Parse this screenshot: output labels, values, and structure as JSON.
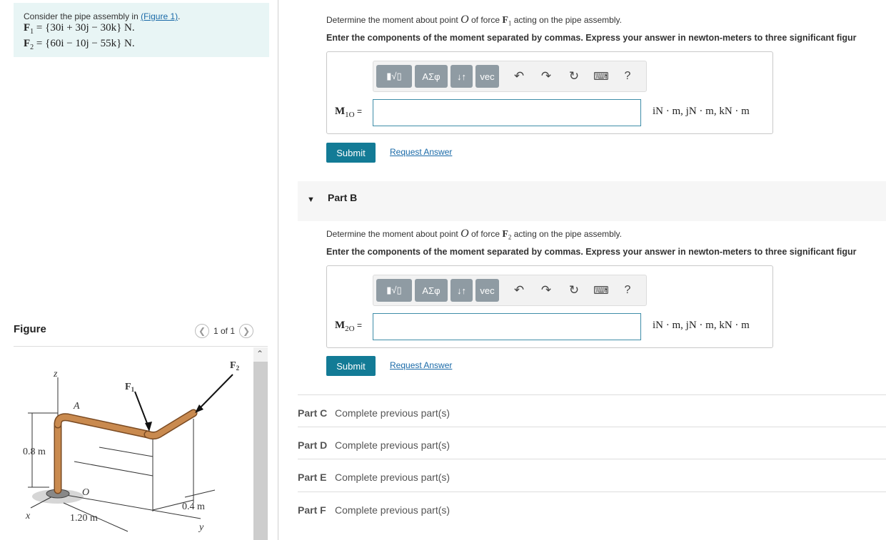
{
  "problem": {
    "intro": "Consider the pipe assembly in",
    "figure_link": "(Figure 1)",
    "period": ".",
    "f1_label": "F",
    "f1_sub": "1",
    "f1_eq": " = {30i + 30j − 30k} N.",
    "f2_label": "F",
    "f2_sub": "2",
    "f2_eq": " = {60i − 10j − 55k} N."
  },
  "figure_panel": {
    "title": "Figure",
    "pager": "1 of 1",
    "prev_icon": "chevron-left-icon",
    "next_icon": "chevron-right-icon",
    "labels": {
      "z": "z",
      "x": "x",
      "y": "y",
      "A": "A",
      "O": "O",
      "F1": "F",
      "F1_sub": "1",
      "F2": "F",
      "F2_sub": "2",
      "dim_08": "0.8 m",
      "dim_120": "1.20 m",
      "dim_04": "0.4 m"
    }
  },
  "part_a": {
    "q_pre": "Determine the moment about point ",
    "q_point": "O",
    "q_mid": " of force ",
    "q_force": "F",
    "q_force_sub": "1",
    "q_post": " acting on the pipe assembly.",
    "instruction": "Enter the components of the moment separated by commas. Express your answer in newton-meters to three significant figur",
    "answer_label": "M",
    "answer_sub": "1O",
    "answer_eq": " =",
    "answer_value": "",
    "units": "iN · m, jN · m, kN · m",
    "submit": "Submit",
    "request": "Request Answer"
  },
  "part_b": {
    "label": "Part B",
    "q_pre": "Determine the moment about point ",
    "q_point": "O",
    "q_mid": " of force ",
    "q_force": "F",
    "q_force_sub": "2",
    "q_post": " acting on the pipe assembly.",
    "instruction": "Enter the components of the moment separated by commas. Express your answer in newton-meters to three significant figur",
    "answer_label": "M",
    "answer_sub": "2O",
    "answer_eq": " =",
    "answer_value": "",
    "units": "iN · m, jN · m, kN · m",
    "submit": "Submit",
    "request": "Request Answer"
  },
  "toolbar": {
    "templates": "▮√▯",
    "greek": "ΑΣφ",
    "arrows": "↓↑",
    "vec": "vec",
    "undo_icon": "undo-icon",
    "redo_icon": "redo-icon",
    "reset_icon": "reset-icon",
    "keyboard_icon": "keyboard-icon",
    "help": "?"
  },
  "parts_locked": [
    {
      "label": "Part C",
      "text": "Complete previous part(s)"
    },
    {
      "label": "Part D",
      "text": "Complete previous part(s)"
    },
    {
      "label": "Part E",
      "text": "Complete previous part(s)"
    },
    {
      "label": "Part F",
      "text": "Complete previous part(s)"
    }
  ],
  "colors": {
    "problem_bg": "#e8f5f5",
    "submit_bg": "#137b96",
    "link": "#1a6aa8",
    "toolbar_btn": "#8f9ba3",
    "pipe": "#c98a4f"
  }
}
